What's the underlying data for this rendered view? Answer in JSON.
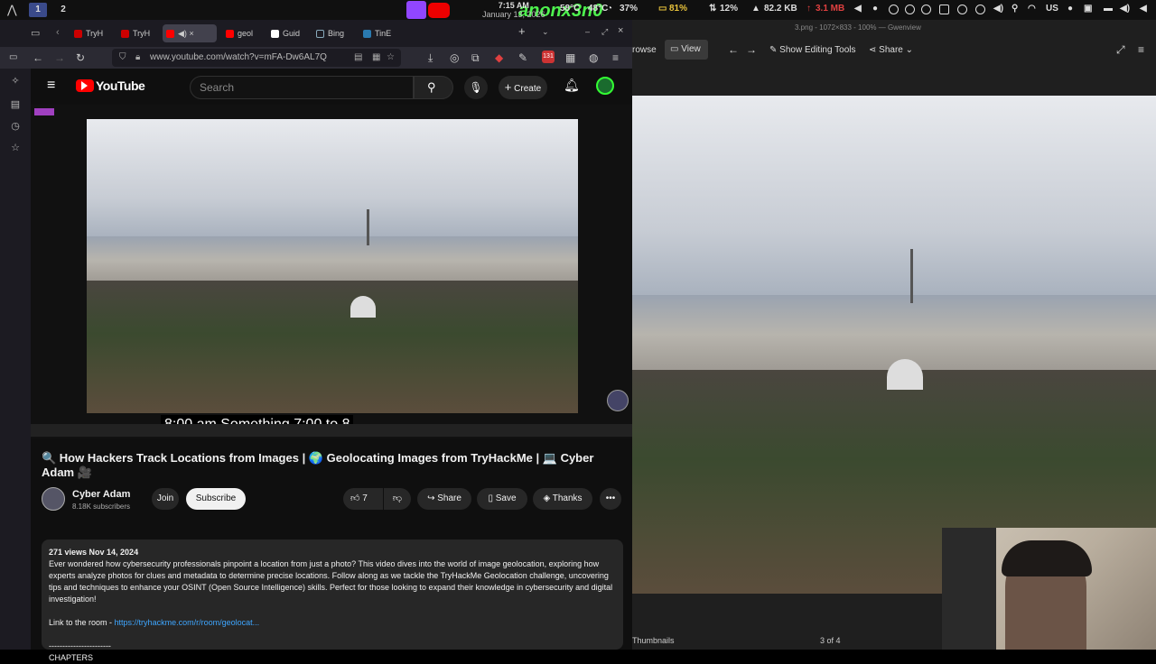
{
  "sysbar": {
    "workspaces": [
      "1",
      "2"
    ],
    "clock_time": "7:15 AM",
    "clock_date": "January 13, 2026",
    "temp1": "58°C",
    "temp2": "48°C",
    "cpu": "37%",
    "battery": "81%",
    "mem": "12%",
    "net_down": "82.2 KB",
    "net_up": "3.1 MB",
    "kbd": "US",
    "overlay_brand": "anonx3n0"
  },
  "browser": {
    "tabs": [
      "TryH",
      "TryH",
      "",
      "geol",
      "Guid",
      "Bing",
      "TinE",
      "",
      "",
      "+"
    ],
    "url": "www.youtube.com/watch?v=mFA-Dw6AL7Q",
    "ext_badge": "131"
  },
  "youtube": {
    "logo": "YouTube",
    "search_placeholder": "Search",
    "create_label": "Create",
    "captions": "8:00 am Something 7:00 to 8",
    "title": "🔍 How Hackers Track Locations from Images | 🌍 Geolocating Images from TryHackMe | 💻 Cyber Adam 🎥",
    "channel": "Cyber Adam",
    "subs": "8.18K subscribers",
    "join": "Join",
    "subscribe": "Subscribe",
    "likes": "7",
    "share": "Share",
    "save": "Save",
    "thanks": "Thanks",
    "views_date": "271 views  Nov 14, 2024",
    "description": "Ever wondered how cybersecurity professionals pinpoint a location from just a photo? This video dives into the world of image geolocation, exploring how experts analyze photos for clues and metadata to determine precise locations. Follow along as we tackle the TryHackMe Geolocation challenge, uncovering tips and techniques to enhance your OSINT (Open Source Intelligence) skills. Perfect for those looking to expand their knowledge in cybersecurity and digital investigation!",
    "link_prefix": "Link to the room - ",
    "link": "https://tryhackme.com/r/room/geolocat...",
    "divider": "-----------------------",
    "chapters": "CHAPTERS"
  },
  "viewer": {
    "window_title": "3.png - 1072×833 - 100% — Gwenview",
    "browse": "rowse",
    "view": "View",
    "edit_tools": "Show Editing Tools",
    "share": "Share",
    "thumbnails": "Thumbnails",
    "counter": "3 of 4"
  }
}
